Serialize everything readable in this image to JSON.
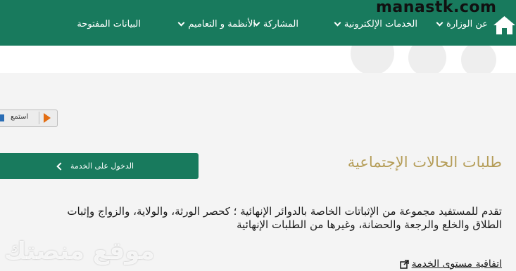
{
  "watermark_top": "manastk.com",
  "watermark_bottom": "موقع منصتك",
  "nav": {
    "home_icon": "home-icon",
    "items": [
      {
        "label": "عن الوزارة",
        "has_dropdown": true
      },
      {
        "label": "الخدمات الإلكترونية",
        "has_dropdown": true
      },
      {
        "label": "المشاركة",
        "has_dropdown": true
      },
      {
        "label": "الأنظمة و التعاميم",
        "has_dropdown": true
      },
      {
        "label": "البيانات المفتوحة",
        "has_dropdown": false
      }
    ]
  },
  "listen_widget": {
    "label": "استمع"
  },
  "service": {
    "title": "طلبات الحالات الإجتماعية",
    "enter_button": "الدخول على الخدمة",
    "description_line1": "تقدم للمستفيد مجموعة من الإثباتات الخاصة بالدوائر الإنهائية ؛ كحصر الورثة، والولاية، والزواج وإثبات",
    "description_line2": "الطلاق والخلع والرجعة والحضانة، وغيرها من الطلبات الإنهائية",
    "sla_link": "اتفاقية مستوى الخدمة"
  },
  "colors": {
    "brand_green": "#187a5d",
    "title_gold": "#b59d58",
    "play_orange": "#e36e13"
  }
}
